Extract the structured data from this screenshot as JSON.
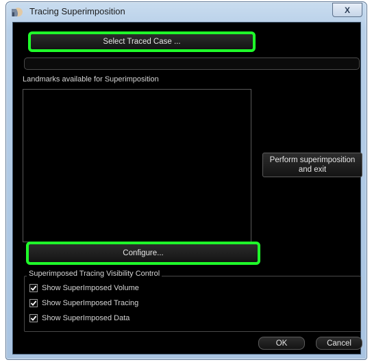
{
  "window": {
    "title": "Tracing Superimposition",
    "close_label": "X"
  },
  "buttons": {
    "select_traced_case": "Select Traced Case ...",
    "configure": "Configure...",
    "perform_line1": "Perform superimposition",
    "perform_line2": "and exit",
    "ok": "OK",
    "cancel": "Cancel"
  },
  "landmarks": {
    "label": "Landmarks available for Superimposition",
    "items": []
  },
  "visibility": {
    "title": "Superimposed Tracing Visibility Control",
    "options": [
      {
        "label": "Show SuperImposed Volume",
        "checked": true
      },
      {
        "label": "Show SuperImposed Tracing",
        "checked": true
      },
      {
        "label": "Show SuperImposed Data",
        "checked": true
      }
    ]
  },
  "colors": {
    "highlight": "#1fff2a",
    "background": "#000000"
  }
}
